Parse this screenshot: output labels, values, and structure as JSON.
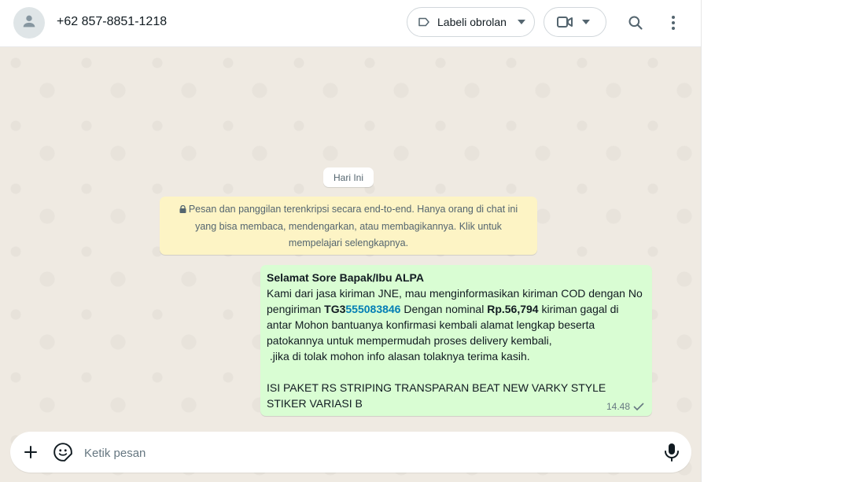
{
  "header": {
    "contact_name": "+62 857-8851-1218",
    "label_button": "Labeli obrolan"
  },
  "chat": {
    "date_chip": "Hari Ini",
    "encryption_notice": "Pesan dan panggilan terenkripsi secara end-to-end. Hanya orang di chat ini yang bisa membaca, mendengarkan, atau membagikannya. Klik untuk mempelajari selengkapnya.",
    "message": {
      "greeting": "Selamat Sore Bapak/Ibu ALPA",
      "line1": "Kami dari jasa kiriman JNE, mau menginformasikan kiriman COD dengan No pengiriman ",
      "tracking_prefix": "TG3",
      "tracking_number": "555083846",
      "line2": " Dengan nominal ",
      "amount": "Rp.56,794",
      "line3": " kiriman gagal di antar Mohon bantuanya konfirmasi kembali alamat lengkap beserta patokannya untuk mempermudah proses delivery kembali,",
      "line4": " .jika di tolak mohon info alasan tolaknya terima kasih.",
      "line5": "ISI PAKET RS STRIPING TRANSPARAN BEAT NEW VARKY STYLE STIKER VARIASI B",
      "time": "14.48"
    }
  },
  "composer": {
    "placeholder": "Ketik pesan"
  },
  "colors": {
    "bubble_out": "#d9fdd3",
    "encryption_bg": "#fdf4c5",
    "chat_bg": "#efeae2",
    "link": "#027eb5"
  }
}
